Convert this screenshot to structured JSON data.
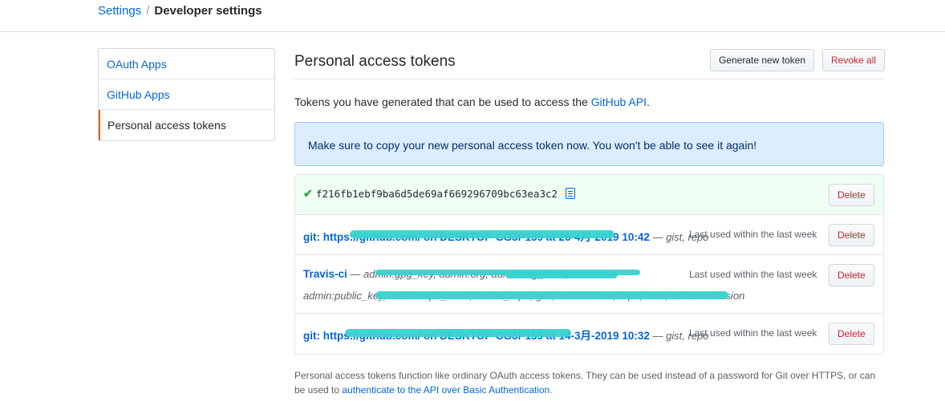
{
  "breadcrumb": {
    "parent": "Settings",
    "separator": "/",
    "current": "Developer settings"
  },
  "sidebar": {
    "items": [
      {
        "label": "OAuth Apps"
      },
      {
        "label": "GitHub Apps"
      },
      {
        "label": "Personal access tokens",
        "selected": true
      }
    ]
  },
  "header": {
    "title": "Personal access tokens",
    "generate_label": "Generate new token",
    "revoke_label": "Revoke all"
  },
  "intro": {
    "text_before": "Tokens you have generated that can be used to access the ",
    "link": "GitHub API",
    "text_after": "."
  },
  "flash": {
    "message": "Make sure to copy your new personal access token now. You won't be able to see it again!"
  },
  "tokens": {
    "new_token": {
      "value": "f216fb1ebf9ba6d5de69af669296709bc63ea3c2",
      "delete_label": "Delete"
    },
    "items": [
      {
        "name": "git: https://github.com/ on DESKTOP-CG3P159 at 26-4月-2019 10:42",
        "scopes": " — gist, repo",
        "last_used": "Last used within the last week",
        "delete_label": "Delete"
      },
      {
        "name": "Travis-ci",
        "scopes": " — admin:gpg_key, admin:org, admin:org_hook,",
        "scopes_line2": "admin:public_key, admin:repo_hook, delete_repo, gist, notifications, repo, user, write:discussion",
        "last_used": "Last used within the last week",
        "delete_label": "Delete"
      },
      {
        "name": "git: https://github.com/ on DESKTOP-CG3P159 at 14-3月-2019 10:32",
        "scopes": " — gist, repo",
        "last_used": "Last used within the last week",
        "delete_label": "Delete"
      }
    ]
  },
  "footer": {
    "text": "Personal access tokens function like ordinary OAuth access tokens. They can be used instead of a password for Git over HTTPS, or can be used to ",
    "link": "authenticate to the API over Basic Authentication",
    "text_after": "."
  },
  "colors": {
    "accent": "#0366d6",
    "danger": "#cb2431",
    "success": "#28a745",
    "selected_bar": "#e36209",
    "redaction": "#36d3cf"
  },
  "icons": {
    "check": "check-icon",
    "copy": "clipboard-icon"
  }
}
